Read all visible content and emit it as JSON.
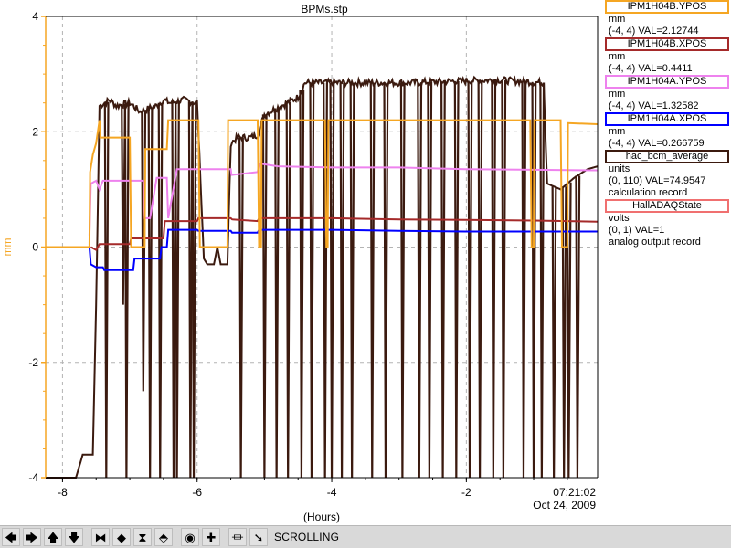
{
  "window": {
    "title": "BPMs.stp"
  },
  "chart_data": {
    "type": "line",
    "title": "BPMs.stp",
    "xlabel": "(Hours)",
    "ylabel": "mm",
    "xlim": [
      -8.25,
      -0.05
    ],
    "ylim": [
      -4,
      4
    ],
    "x_ticks": [
      -8,
      -6,
      -4,
      -2
    ],
    "y_ticks": [
      -4,
      -2,
      0,
      2,
      4
    ],
    "end_time": "07:21:02",
    "end_date": "Oct 24, 2009",
    "grid": true,
    "legend_position": "right",
    "series": [
      {
        "name": "IPM1H04B.YPOS",
        "units": "mm",
        "range": "(-4, 4)",
        "value_text": "VAL=2.12744",
        "extra": "",
        "color": "#f5a623",
        "points": [
          [
            -8.25,
            0.0
          ],
          [
            -7.6,
            0.0
          ],
          [
            -7.59,
            1.3
          ],
          [
            -7.55,
            1.6
          ],
          [
            -7.5,
            1.8
          ],
          [
            -7.45,
            2.2
          ],
          [
            -7.44,
            1.9
          ],
          [
            -7.0,
            1.9
          ],
          [
            -6.98,
            0.0
          ],
          [
            -6.78,
            0.0
          ],
          [
            -6.77,
            1.7
          ],
          [
            -6.45,
            1.7
          ],
          [
            -6.43,
            2.2
          ],
          [
            -5.98,
            2.2
          ],
          [
            -5.96,
            0.0
          ],
          [
            -5.55,
            0.0
          ],
          [
            -5.54,
            2.2
          ],
          [
            -5.1,
            2.2
          ],
          [
            -5.08,
            0.0
          ],
          [
            -5.05,
            0.0
          ],
          [
            -5.04,
            2.2
          ],
          [
            -4.1,
            2.2
          ],
          [
            -4.08,
            0.0
          ],
          [
            -4.06,
            0.0
          ],
          [
            -4.05,
            2.2
          ],
          [
            -1.05,
            2.2
          ],
          [
            -1.03,
            0.0
          ],
          [
            -1.0,
            0.0
          ],
          [
            -0.99,
            2.2
          ],
          [
            -0.6,
            2.2
          ],
          [
            -0.58,
            0.0
          ],
          [
            -0.5,
            0.0
          ],
          [
            -0.49,
            2.15
          ],
          [
            -0.05,
            2.13
          ]
        ]
      },
      {
        "name": "IPM1H04B.XPOS",
        "units": "mm",
        "range": "(-4, 4)",
        "value_text": "VAL=0.4411",
        "extra": "",
        "color": "#a52a2a",
        "points": [
          [
            -7.58,
            0.0
          ],
          [
            -7.5,
            -0.05
          ],
          [
            -7.45,
            0.05
          ],
          [
            -7.0,
            0.05
          ],
          [
            -6.98,
            0.15
          ],
          [
            -6.5,
            0.15
          ],
          [
            -6.48,
            0.45
          ],
          [
            -6.0,
            0.45
          ],
          [
            -5.98,
            0.5
          ],
          [
            -5.5,
            0.5
          ],
          [
            -5.48,
            0.48
          ],
          [
            -5.1,
            0.45
          ],
          [
            -5.08,
            0.5
          ],
          [
            -4.0,
            0.5
          ],
          [
            -3.0,
            0.48
          ],
          [
            -2.0,
            0.47
          ],
          [
            -1.0,
            0.46
          ],
          [
            -0.05,
            0.44
          ]
        ]
      },
      {
        "name": "IPM1H04A.YPOS",
        "units": "mm",
        "range": "(-4, 4)",
        "value_text": "VAL=1.32582",
        "extra": "",
        "color": "#ee82ee",
        "points": [
          [
            -7.6,
            0.2
          ],
          [
            -7.58,
            1.1
          ],
          [
            -7.5,
            1.15
          ],
          [
            -7.45,
            1.0
          ],
          [
            -7.4,
            1.15
          ],
          [
            -6.8,
            1.15
          ],
          [
            -6.78,
            0.5
          ],
          [
            -6.7,
            0.5
          ],
          [
            -6.6,
            1.2
          ],
          [
            -6.45,
            1.2
          ],
          [
            -6.43,
            0.5
          ],
          [
            -6.3,
            1.35
          ],
          [
            -5.5,
            1.35
          ],
          [
            -5.49,
            1.25
          ],
          [
            -5.1,
            1.3
          ],
          [
            -5.08,
            1.45
          ],
          [
            -4.8,
            1.4
          ],
          [
            -4.0,
            1.38
          ],
          [
            -3.0,
            1.38
          ],
          [
            -2.0,
            1.35
          ],
          [
            -1.0,
            1.34
          ],
          [
            -0.05,
            1.33
          ]
        ]
      },
      {
        "name": "IPM1H04A.XPOS",
        "units": "mm",
        "range": "(-4, 4)",
        "value_text": "VAL=0.266759",
        "extra": "",
        "color": "#0000ff",
        "points": [
          [
            -7.6,
            0.0
          ],
          [
            -7.58,
            -0.3
          ],
          [
            -7.5,
            -0.35
          ],
          [
            -7.4,
            -0.35
          ],
          [
            -7.38,
            -0.4
          ],
          [
            -6.95,
            -0.4
          ],
          [
            -6.93,
            -0.2
          ],
          [
            -6.55,
            -0.2
          ],
          [
            -6.53,
            0.0
          ],
          [
            -6.45,
            0.0
          ],
          [
            -6.43,
            0.3
          ],
          [
            -6.0,
            0.3
          ],
          [
            -5.98,
            0.28
          ],
          [
            -5.5,
            0.28
          ],
          [
            -5.48,
            0.25
          ],
          [
            -5.1,
            0.25
          ],
          [
            -5.08,
            0.3
          ],
          [
            -4.0,
            0.3
          ],
          [
            -3.0,
            0.28
          ],
          [
            -2.0,
            0.27
          ],
          [
            -1.0,
            0.27
          ],
          [
            -0.05,
            0.27
          ]
        ]
      },
      {
        "name": "hac_bcm_average",
        "units": "units",
        "range": "(0, 110)",
        "value_text": "VAL=74.9547",
        "extra": "calculation record",
        "color": "#3b1a0f",
        "base": [
          [
            -8.25,
            -4.0
          ],
          [
            -7.8,
            -4.0
          ],
          [
            -7.7,
            -3.6
          ],
          [
            -7.55,
            -3.6
          ],
          [
            -7.5,
            -1.0
          ],
          [
            -7.45,
            2.45
          ],
          [
            -7.3,
            2.55
          ],
          [
            -7.2,
            2.45
          ],
          [
            -7.0,
            2.5
          ],
          [
            -6.85,
            2.35
          ],
          [
            -6.6,
            2.45
          ],
          [
            -6.5,
            2.55
          ],
          [
            -6.4,
            2.5
          ],
          [
            -6.2,
            2.55
          ],
          [
            -6.0,
            2.5
          ],
          [
            -5.9,
            -0.2
          ],
          [
            -5.85,
            -0.3
          ],
          [
            -5.75,
            -0.3
          ],
          [
            -5.7,
            0.0
          ],
          [
            -5.65,
            -0.3
          ],
          [
            -5.6,
            -0.3
          ],
          [
            -5.55,
            -0.3
          ],
          [
            -5.5,
            1.8
          ],
          [
            -5.4,
            1.9
          ],
          [
            -5.2,
            1.9
          ],
          [
            -5.1,
            1.95
          ],
          [
            -5.0,
            2.3
          ],
          [
            -4.5,
            2.6
          ],
          [
            -4.4,
            2.85
          ],
          [
            -2.9,
            2.85
          ],
          [
            -1.55,
            2.9
          ],
          [
            -0.85,
            2.85
          ],
          [
            -0.8,
            1.1
          ],
          [
            -0.6,
            1.0
          ],
          [
            -0.4,
            1.2
          ],
          [
            -0.2,
            1.35
          ],
          [
            -0.05,
            1.4
          ]
        ],
        "dips": [
          [
            -7.35,
            -4.0
          ],
          [
            -7.1,
            -1.0
          ],
          [
            -7.05,
            -4.0
          ],
          [
            -6.8,
            -2.5
          ],
          [
            -6.7,
            -4.0
          ],
          [
            -6.55,
            -4.0
          ],
          [
            -6.35,
            -4.0
          ],
          [
            -6.3,
            -4.0
          ],
          [
            -6.1,
            -4.0
          ],
          [
            -6.05,
            -4.0
          ],
          [
            -5.35,
            -4.0
          ],
          [
            -5.0,
            -4.0
          ],
          [
            -4.82,
            -4.0
          ],
          [
            -4.65,
            -4.0
          ],
          [
            -4.45,
            -4.0
          ],
          [
            -4.3,
            -4.0
          ],
          [
            -4.1,
            -4.0
          ],
          [
            -4.0,
            -4.0
          ],
          [
            -3.85,
            -4.0
          ],
          [
            -3.7,
            -4.0
          ],
          [
            -3.4,
            -4.0
          ],
          [
            -3.2,
            -4.0
          ],
          [
            -2.95,
            -4.0
          ],
          [
            -2.7,
            -4.0
          ],
          [
            -2.55,
            -4.0
          ],
          [
            -2.35,
            -4.0
          ],
          [
            -2.15,
            -4.0
          ],
          [
            -1.95,
            -4.0
          ],
          [
            -1.8,
            -4.0
          ],
          [
            -1.6,
            -4.0
          ],
          [
            -1.45,
            -4.0
          ],
          [
            -1.15,
            -4.0
          ],
          [
            -1.0,
            -4.0
          ],
          [
            -0.88,
            -4.0
          ],
          [
            -0.7,
            -4.0
          ],
          [
            -0.55,
            -4.0
          ],
          [
            -0.48,
            -4.0
          ],
          [
            -0.35,
            -4.0
          ]
        ]
      },
      {
        "name": "HallADAQState",
        "units": "volts",
        "range": "(0, 1)",
        "value_text": "VAL=1",
        "extra": "analog output record",
        "color": "#f07070",
        "points": []
      }
    ]
  },
  "toolbar": {
    "buttons": [
      {
        "name": "pan-left-button",
        "glyph": "🡄"
      },
      {
        "name": "pan-right-button",
        "glyph": "🡆"
      },
      {
        "name": "pan-up-button",
        "glyph": "🡅"
      },
      {
        "name": "pan-down-button",
        "glyph": "🡇"
      },
      {
        "name": "zoom-in-x-button",
        "glyph": "⧓"
      },
      {
        "name": "zoom-out-x-button",
        "glyph": "◆"
      },
      {
        "name": "zoom-in-y-button",
        "glyph": "⧗"
      },
      {
        "name": "zoom-out-y-button",
        "glyph": "⬘"
      },
      {
        "name": "auto-scale-button",
        "glyph": "◉"
      },
      {
        "name": "zoom-reset-button",
        "glyph": "✚"
      },
      {
        "name": "scroll-toggle-button",
        "glyph": "⏛"
      },
      {
        "name": "pointer-button",
        "glyph": "➘"
      }
    ],
    "status": "SCROLLING"
  }
}
